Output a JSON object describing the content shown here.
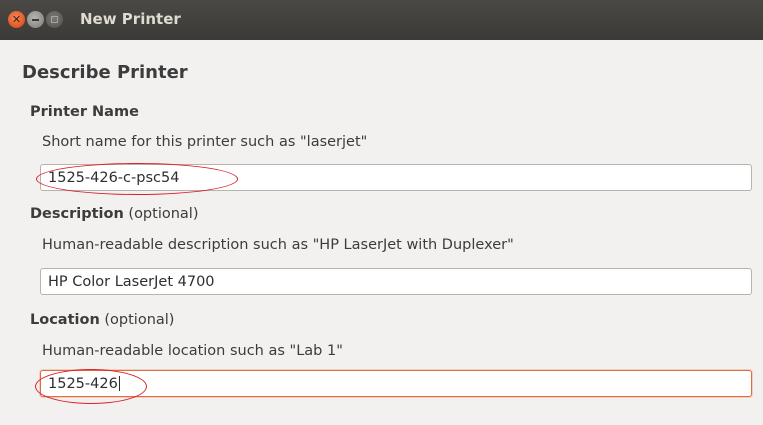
{
  "window": {
    "title": "New Printer"
  },
  "page": {
    "heading": "Describe Printer"
  },
  "printer_name": {
    "label": "Printer Name",
    "hint": "Short name for this printer such as \"laserjet\"",
    "value": "1525-426-c-psc54"
  },
  "description": {
    "label": "Description",
    "optional": " (optional)",
    "hint": "Human-readable description such as \"HP LaserJet with Duplexer\"",
    "value": "HP Color LaserJet 4700"
  },
  "location": {
    "label": "Location",
    "optional": " (optional)",
    "hint": "Human-readable location such as \"Lab 1\"",
    "value": "1525-426"
  },
  "colors": {
    "focus_border": "#e36c3f",
    "annotation": "#d9212b"
  }
}
